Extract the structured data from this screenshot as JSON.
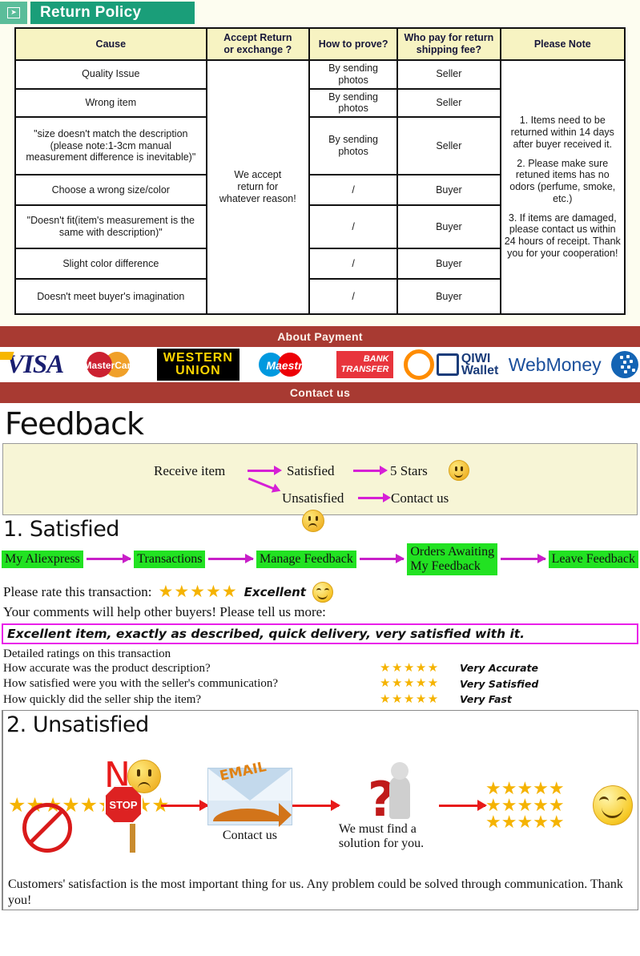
{
  "return_policy": {
    "banner_title": "Return Policy",
    "banner_icon": "mail-forward-icon",
    "table": {
      "headers": [
        "Cause",
        "Accept Return or exchange ?",
        "How to prove?",
        "Who pay for return shipping fee?",
        "Please Note"
      ],
      "header_accept_line1": "Accept Return",
      "header_accept_line2": "or exchange ?",
      "header_pay_line1": "Who pay for return",
      "header_pay_line2": "shipping fee?",
      "accept_cell": "We accept return for whatever reason!",
      "accept_cell_l1": "We accept",
      "accept_cell_l2": "return for",
      "accept_cell_l3": "whatever reason!",
      "rows": [
        {
          "cause": "Quality Issue",
          "prove": "By sending photos",
          "pay": "Seller"
        },
        {
          "cause": "Wrong item",
          "prove": "By sending photos",
          "pay": "Seller"
        },
        {
          "cause": "\"size doesn't match the description (please note:1-3cm manual measurement difference is inevitable)\"",
          "prove": "By sending photos",
          "pay": "Seller"
        },
        {
          "cause": "Choose a wrong size/color",
          "prove": "/",
          "pay": "Buyer"
        },
        {
          "cause": "\"Doesn't fit(item's measurement is the same with description)\"",
          "prove": "/",
          "pay": "Buyer"
        },
        {
          "cause": "Slight color difference",
          "prove": "/",
          "pay": "Buyer"
        },
        {
          "cause": "Doesn't meet buyer's imagination",
          "prove": "/",
          "pay": "Buyer"
        }
      ],
      "notes": [
        "1. Items need to be returned within 14 days after buyer received it.",
        "2. Please make sure retuned items has no odors (perfume, smoke, etc.)",
        "3. If items are damaged, please contact us within 24 hours of receipt. Thank you for your cooperation!"
      ]
    }
  },
  "payment": {
    "banner": "About Payment",
    "contact_banner": "Contact us",
    "logos": [
      {
        "name": "visa",
        "text": "VISA"
      },
      {
        "name": "mastercard",
        "text": "MasterCard"
      },
      {
        "name": "western-union",
        "line1": "WESTERN",
        "line2": "UNION"
      },
      {
        "name": "maestro",
        "text": "Maestro"
      },
      {
        "name": "bank-transfer",
        "line1": "BANK",
        "line2": "TRANSFER"
      },
      {
        "name": "qiwi-wallet",
        "line1": "QIWI",
        "line2": "Wallet"
      },
      {
        "name": "webmoney",
        "text": "WebMoney"
      }
    ]
  },
  "feedback": {
    "title": "Feedback",
    "flow": {
      "start": "Receive item",
      "satisfied": "Satisfied",
      "unsatisfied": "Unsatisfied",
      "satisfied_result": "5 Stars",
      "unsatisfied_result": "Contact us"
    },
    "section1": {
      "heading": "1. Satisfied",
      "steps": [
        "My Aliexpress",
        "Transactions",
        "Manage Feedback",
        "Orders Awaiting My Feedback",
        "Leave Feedback"
      ],
      "step4_l1": "Orders Awaiting",
      "step4_l2": "My Feedback",
      "rate_label": "Please rate this transaction:",
      "rate_stars": "★★★★★",
      "rate_word": "Excellent",
      "comments_prompt": "Your comments will help other buyers! Please tell us more:",
      "comment_text": "Excellent item, exactly as described, quick delivery, very satisfied with it.",
      "detailed_heading": "Detailed ratings on this transaction",
      "detailed": [
        {
          "question": "How accurate was the product description?",
          "stars": "★★★★★",
          "label": "Very Accurate"
        },
        {
          "question": "How satisfied were you with the seller's communication?",
          "stars": "★★★★★",
          "label": "Very Satisfied"
        },
        {
          "question": "How quickly did the seller ship the item?",
          "stars": "★★★★★",
          "label": "Very Fast"
        }
      ]
    },
    "section2": {
      "heading": "2. Unsatisfied",
      "no_text": "N",
      "stop_text": "STOP",
      "email_text": "EMAIL",
      "contact_caption": "Contact us",
      "solution_caption": "We must find a solution for you.",
      "bad_stars": "★★★★★★★★★",
      "good_stars_row": "★★★★★",
      "footnote": "Customers' satisfaction is the most important thing for us. Any problem could be solved through communication. Thank you!"
    }
  },
  "colors": {
    "teal": "#1a9e79",
    "red_banner": "#a83a32",
    "header_yellow": "#f7f3c2",
    "flow_bg": "#f7f5d6",
    "magenta": "#d61fd6",
    "green_step": "#22e222",
    "star_gold": "#f5b301",
    "red_arrow": "#e81a1a"
  }
}
